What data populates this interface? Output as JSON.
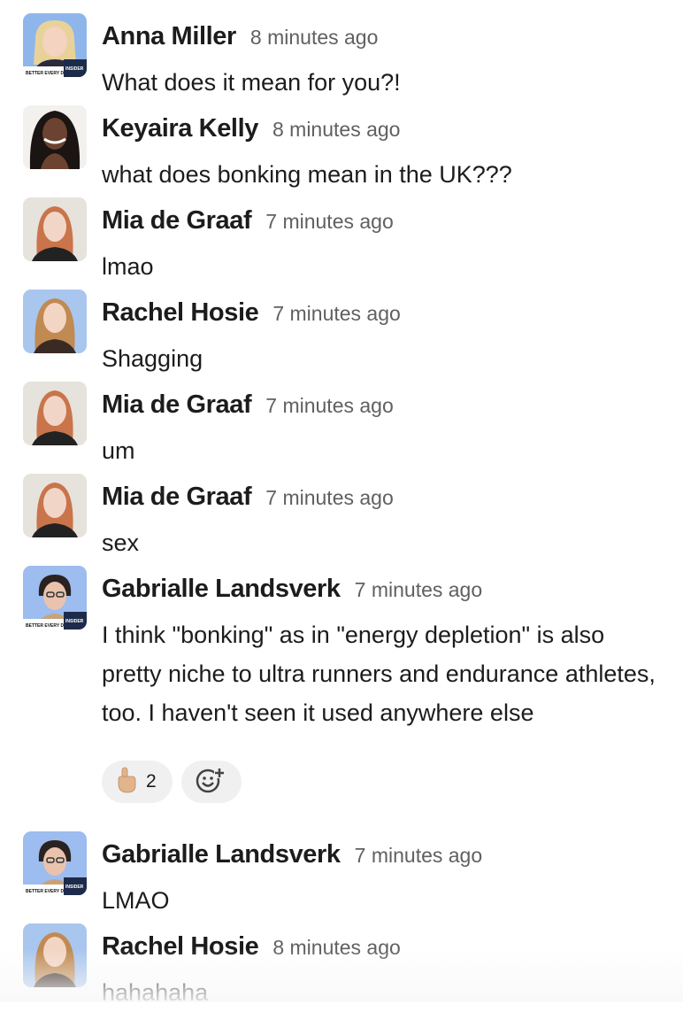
{
  "messages": [
    {
      "author": "Anna Miller",
      "time": "8 minutes ago",
      "text": "What does it mean for you?!",
      "avatar": "anna-miller-avatar",
      "avatar_badge": "BETTER EVERY DAY INSIDER"
    },
    {
      "author": "Keyaira Kelly",
      "time": "8 minutes ago",
      "text": "what does bonking mean in the UK???",
      "avatar": "keyaira-kelly-avatar"
    },
    {
      "author": "Mia de Graaf",
      "time": "7 minutes ago",
      "text": "lmao",
      "avatar": "mia-de-graaf-avatar"
    },
    {
      "author": "Rachel Hosie",
      "time": "7 minutes ago",
      "text": "Shagging",
      "avatar": "rachel-hosie-avatar"
    },
    {
      "author": "Mia de Graaf",
      "time": "7 minutes ago",
      "text": "um",
      "avatar": "mia-de-graaf-avatar"
    },
    {
      "author": "Mia de Graaf",
      "time": "7 minutes ago",
      "text": "sex",
      "avatar": "mia-de-graaf-avatar"
    },
    {
      "author": "Gabrialle Landsverk",
      "time": "7 minutes ago",
      "text": "I think \"bonking\" as in \"energy depletion\" is also pretty niche to ultra runners and endurance athletes, too. I haven't seen it used anywhere else",
      "avatar": "gabrialle-landsverk-avatar",
      "avatar_badge": "BETTER EVERY DAY INSIDER",
      "reactions": [
        {
          "emoji": "pointing-up-hand-icon",
          "count": "2"
        }
      ],
      "add_reaction_icon": "add-emoji-icon"
    },
    {
      "author": "Gabrialle Landsverk",
      "time": "7 minutes ago",
      "text": "LMAO",
      "avatar": "gabrialle-landsverk-avatar",
      "avatar_badge": "BETTER EVERY DAY INSIDER"
    },
    {
      "author": "Rachel Hosie",
      "time": "8 minutes ago",
      "text": "hahahaha",
      "avatar": "rachel-hosie-avatar"
    }
  ],
  "colors": {
    "name": "#1d1c1d",
    "timestamp": "#616061",
    "reaction_bg": "#f0f0f0",
    "insider_blue": "#8fb6ea"
  }
}
